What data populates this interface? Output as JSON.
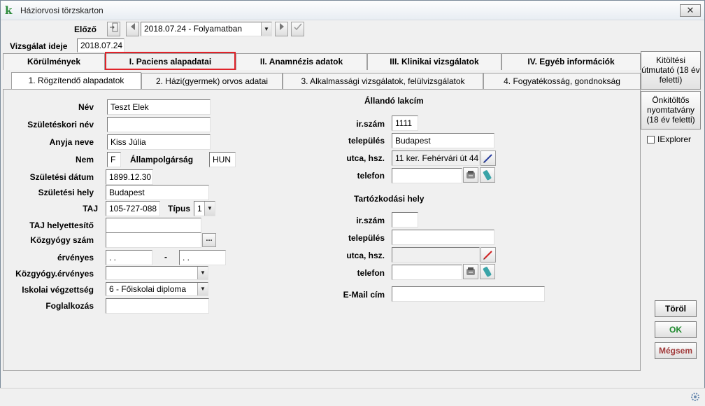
{
  "window": {
    "title": "Háziorvosi törzskarton",
    "close_symbol": "✕"
  },
  "header": {
    "prev_label": "Előző",
    "exam_label": "Vizsgálat ideje",
    "exam_value": "2018.07.24",
    "visit_combo": "2018.07.24 - Folyamatban"
  },
  "tabs": [
    {
      "label": "Körülmények"
    },
    {
      "label": "I. Paciens alapadatai"
    },
    {
      "label": "II. Anamnézis adatok"
    },
    {
      "label": "III. Klinikai vizsgálatok"
    },
    {
      "label": "IV. Egyéb információk"
    }
  ],
  "subtabs": [
    {
      "label": "1. Rögzítendő alapadatok"
    },
    {
      "label": "2. Házi(gyermek) orvos adatai"
    },
    {
      "label": "3. Alkalmassági vizsgálatok, felülvizsgálatok"
    },
    {
      "label": "4. Fogyatékosság, gondnokság"
    }
  ],
  "side": {
    "guide_label": "Kitöltési útmutató (18 év feletti)",
    "selfform_label": "Önkitöltős nyomtatvány (18 év feletti)",
    "iexplorer_label": "IExplorer",
    "iexplorer_checked": false
  },
  "fields": {
    "nev_label": "Név",
    "nev": "Teszt Elek",
    "szuletesi_nev_label": "Születéskori név",
    "szuletesi_nev": "",
    "anyja_label": "Anyja neve",
    "anyja": "Kiss Júlia",
    "nem_label": "Nem",
    "nem": "F",
    "allampolgarsag_label": "Állampolgárság",
    "allampolgarsag": "HUN",
    "szul_datum_label": "Születési dátum",
    "szul_datum": "1899.12.30",
    "szul_hely_label": "Születési hely",
    "szul_hely": "Budapest",
    "taj_label": "TAJ",
    "taj": "105-727-088",
    "tipus_label": "Típus",
    "tipus": "1",
    "taj_helyettesito_label": "TAJ helyettesítő",
    "taj_helyettesito": "",
    "kozgyogy_label": "Közgyógy szám",
    "kozgyogy": "",
    "kozgyogy_btn": "...",
    "ervenyes_label": "érvényes",
    "ervenyes_from": " .  .",
    "ervenyes_sep": "-",
    "ervenyes_to": " .  .",
    "kozgyogy_erv_label": "Közgyógy.érvényes",
    "kozgyogy_erv": "",
    "iskola_label": "Iskolai végzettség",
    "iskola": "6 - Főiskolai diploma",
    "foglalkozas_label": "Foglalkozás",
    "foglalkozas": ""
  },
  "address": {
    "permanent_title": "Állandó lakcím",
    "irszam_label": "ir.szám",
    "irszam": "1111",
    "telepules_label": "település",
    "telepules": "Budapest",
    "utca_label": "utca, hsz.",
    "utca": "11 ker. Fehérvári út 44",
    "telefon_label": "telefon",
    "telefon": "",
    "temp_title": "Tartózkodási hely",
    "t_irszam_label": "ir.szám",
    "t_irszam": "",
    "t_telepules_label": "település",
    "t_telepules": "",
    "t_utca_label": "utca, hsz.",
    "t_utca": "",
    "t_telefon_label": "telefon",
    "t_telefon": "",
    "email_label": "E-Mail cím",
    "email": ""
  },
  "actions": {
    "torol": "Töröl",
    "ok": "OK",
    "megsem": "Mégsem"
  },
  "colors": {
    "ok_text": "#1f8a2e",
    "cancel_text": "#a03a3a",
    "highlight": "#e0232a"
  }
}
